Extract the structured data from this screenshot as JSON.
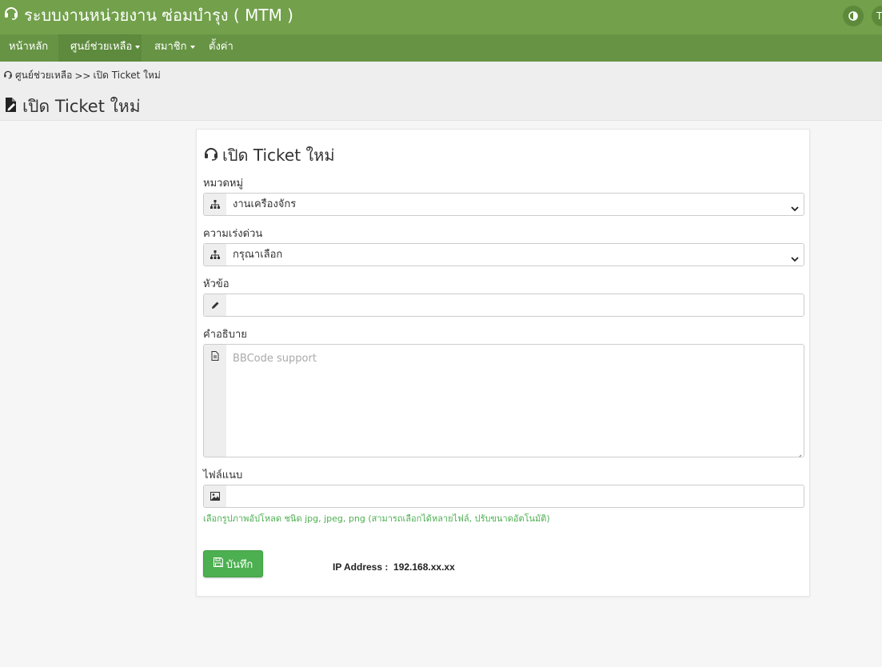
{
  "app": {
    "title": "ระบบงานหน่วยงาน ซ่อมบำรุง ( MTM )",
    "user_initial": "T"
  },
  "nav": {
    "items": [
      {
        "label": "หน้าหลัก",
        "dropdown": false,
        "active": false
      },
      {
        "label": "ศูนย์ช่วยเหลือ",
        "dropdown": true,
        "active": true
      },
      {
        "label": "สมาชิก",
        "dropdown": true,
        "active": false
      },
      {
        "label": "ตั้งค่า",
        "dropdown": false,
        "active": false
      }
    ]
  },
  "breadcrumb": {
    "parent": "ศูนย์ช่วยเหลือ",
    "separator": ">>",
    "current": "เปิด Ticket ใหม่"
  },
  "page": {
    "title": "เปิด Ticket ใหม่"
  },
  "form": {
    "title": "เปิด Ticket ใหม่",
    "category": {
      "label": "หมวดหมู่",
      "value": "งานเครื่องจักร"
    },
    "priority": {
      "label": "ความเร่งด่วน",
      "value": "กรุณาเลือก"
    },
    "subject": {
      "label": "หัวข้อ",
      "value": ""
    },
    "description": {
      "label": "คำอธิบาย",
      "placeholder": "BBCode support",
      "value": ""
    },
    "attachment": {
      "label": "ไฟล์แนบ",
      "hint": "เลือกรูปภาพอัปโหลด ชนิด jpg, jpeg, png (สามารถเลือกได้หลายไฟล์, ปรับขนาดอัตโนมัติ)"
    },
    "save_label": "บันทึก",
    "ip_label": "IP Address :",
    "ip_value": "192.168.xx.xx"
  },
  "colors": {
    "topbar": "#72a04b",
    "navbar": "#669444",
    "accent": "#4caf50"
  },
  "icons": {
    "app": "headset-icon",
    "theme": "contrast-icon",
    "breadcrumb": "headset-icon",
    "page_title": "file-edit-icon",
    "card_title": "headset-icon",
    "category": "sitemap-icon",
    "priority": "sitemap-icon",
    "subject": "pencil-icon",
    "description": "file-text-icon",
    "attachment": "image-icon",
    "save": "floppy-disk-icon"
  }
}
